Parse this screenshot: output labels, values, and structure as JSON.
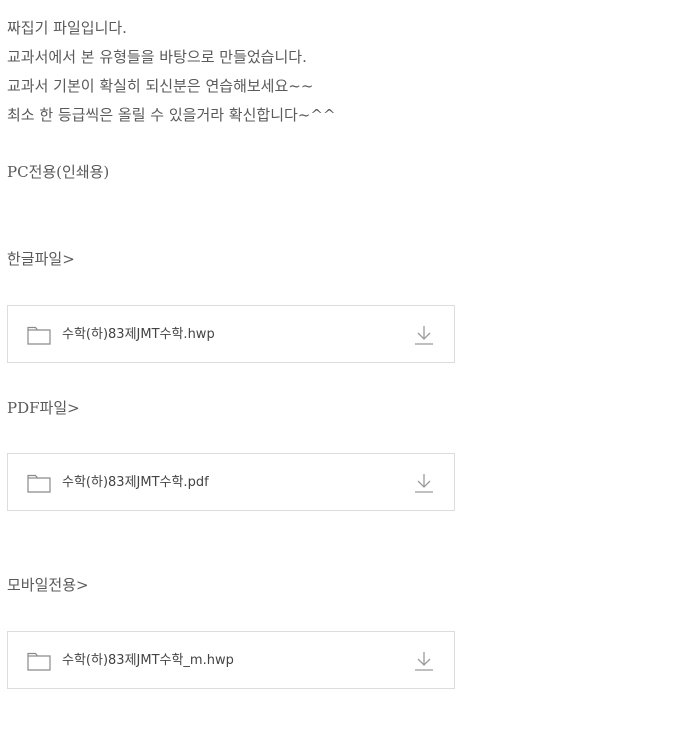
{
  "intro": {
    "lines": [
      "짜집기 파일입니다.",
      "교과서에서 본 유형들을 바탕으로 만들었습니다.",
      "교과서 기본이 확실히 되신분은 연습해보세요~~",
      "최소 한 등급씩은 올릴 수 있을거라 확신합니다~^^"
    ]
  },
  "sections": {
    "pc_label": "PC전용(인쇄용)",
    "hwp_label": "한글파일>",
    "pdf_label": "PDF파일>",
    "mobile_label": "모바일전용>"
  },
  "files": [
    {
      "name": "수학(하)83제JMT수학.hwp"
    },
    {
      "name": "수학(하)83제JMT수학.pdf"
    },
    {
      "name": "수학(하)83제JMT수학_m.hwp"
    }
  ],
  "icons": {
    "folder": "folder-icon",
    "download": "download-icon"
  },
  "colors": {
    "text": "#5a5a5a",
    "border": "#dcdcdc",
    "icon": "#9a9a9a"
  }
}
